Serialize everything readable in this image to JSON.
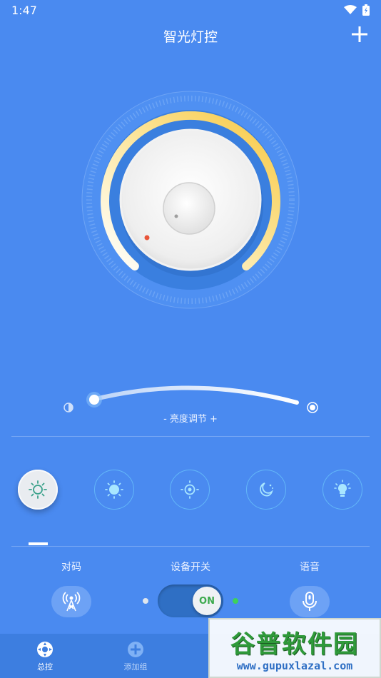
{
  "status_bar": {
    "time": "1:47",
    "wifi_icon": "wifi-icon",
    "battery_icon": "battery-charging-icon"
  },
  "header": {
    "title": "智光灯控",
    "add_icon": "plus-icon"
  },
  "dial": {
    "level": 0.78
  },
  "brightness": {
    "label": "- 亮度调节 +",
    "value": 0.05
  },
  "modes": [
    {
      "name": "mode-sun-outline",
      "icon": "sun-outline-icon",
      "selected": true
    },
    {
      "name": "mode-sun-full",
      "icon": "sun-icon",
      "selected": false
    },
    {
      "name": "mode-sun-dot",
      "icon": "sun-dot-icon",
      "selected": false
    },
    {
      "name": "mode-moon",
      "icon": "moon-icon",
      "selected": false
    },
    {
      "name": "mode-bulb",
      "icon": "bulb-icon",
      "selected": false
    }
  ],
  "controls": {
    "pair_label": "对码",
    "power_label": "设备开关",
    "voice_label": "语音",
    "toggle_text": "ON"
  },
  "bottom_nav": {
    "items": [
      {
        "label": "总控",
        "icon": "master-control-icon"
      },
      {
        "label": "添加组",
        "icon": "add-group-icon"
      }
    ]
  },
  "watermark": {
    "title": "谷普软件园",
    "url": "www.gupuxlazal.com"
  }
}
